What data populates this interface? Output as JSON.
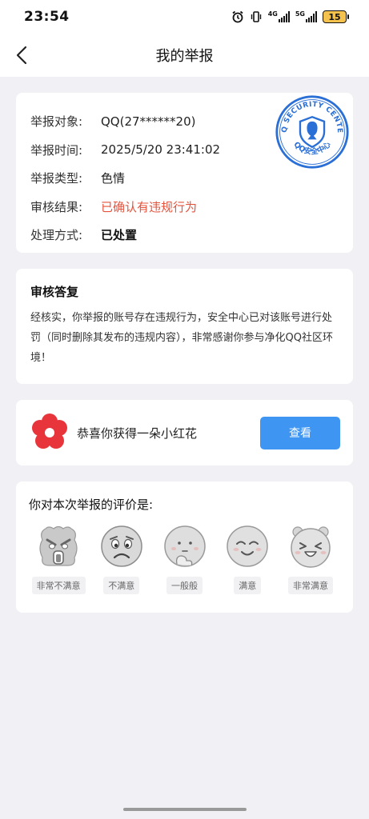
{
  "status_bar": {
    "time": "23:54",
    "network_1": "4G",
    "network_2": "5G",
    "battery": "15"
  },
  "nav": {
    "title": "我的举报"
  },
  "report": {
    "rows": [
      {
        "label": "举报对象:",
        "value": "QQ(27******20)"
      },
      {
        "label": "举报时间:",
        "value": "2025/5/20 23:41:02"
      },
      {
        "label": "举报类型:",
        "value": "色情"
      },
      {
        "label": "审核结果:",
        "value": "已确认有违规行为"
      },
      {
        "label": "处理方式:",
        "value": "已处置"
      }
    ],
    "stamp": {
      "top_text": "QQ SECURITY CENTER",
      "bottom_text": "QQ安全中心"
    },
    "result_color": "#e5533c"
  },
  "review": {
    "title": "审核答复",
    "text": "经核实，你举报的账号存在违规行为，安全中心已对该账号进行处罚（同时删除其发布的违规内容），非常感谢你参与净化QQ社区环境！"
  },
  "reward": {
    "text": "恭喜你获得一朵小红花",
    "button": "查看",
    "button_color": "#3e96f2"
  },
  "rating": {
    "title": "你对本次举报的评价是:",
    "options": [
      {
        "label": "非常不满意",
        "icon": "very-unsatisfied-face-icon"
      },
      {
        "label": "不满意",
        "icon": "unsatisfied-face-icon"
      },
      {
        "label": "一般般",
        "icon": "neutral-face-icon"
      },
      {
        "label": "满意",
        "icon": "satisfied-face-icon"
      },
      {
        "label": "非常满意",
        "icon": "very-satisfied-face-icon"
      }
    ]
  }
}
